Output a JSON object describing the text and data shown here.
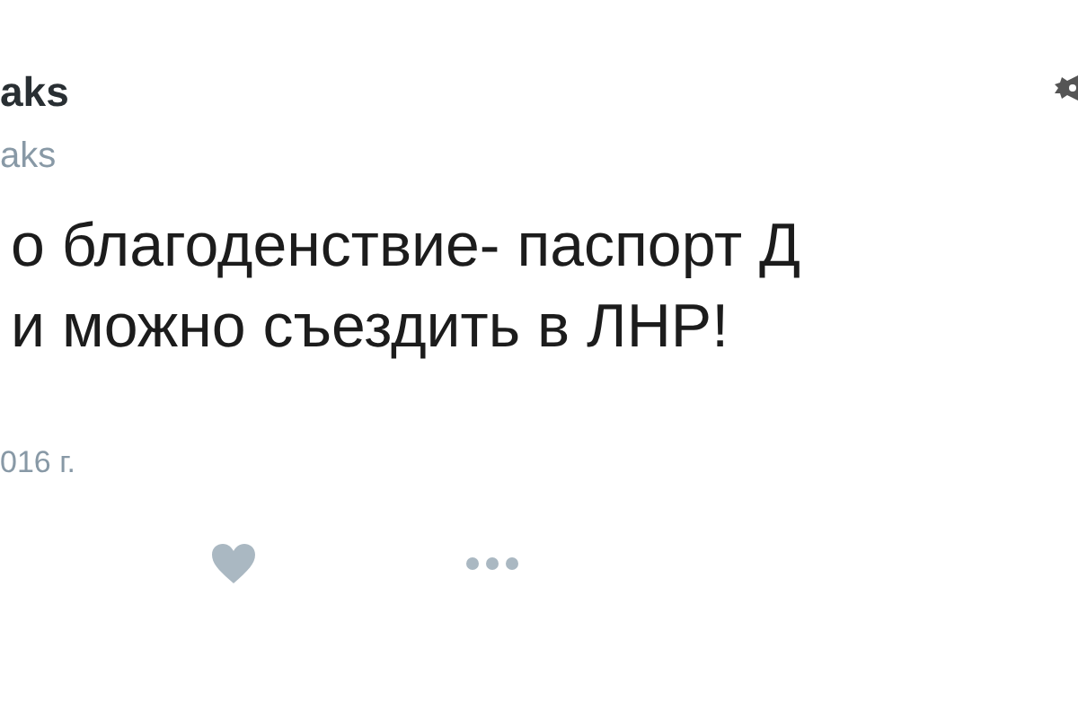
{
  "author": {
    "name": "aks",
    "handle": "aks"
  },
  "tweet": {
    "lines": [
      "о благоденствие- паспорт Д",
      "и можно съездить в ЛНР!"
    ],
    "date": "016 г."
  }
}
